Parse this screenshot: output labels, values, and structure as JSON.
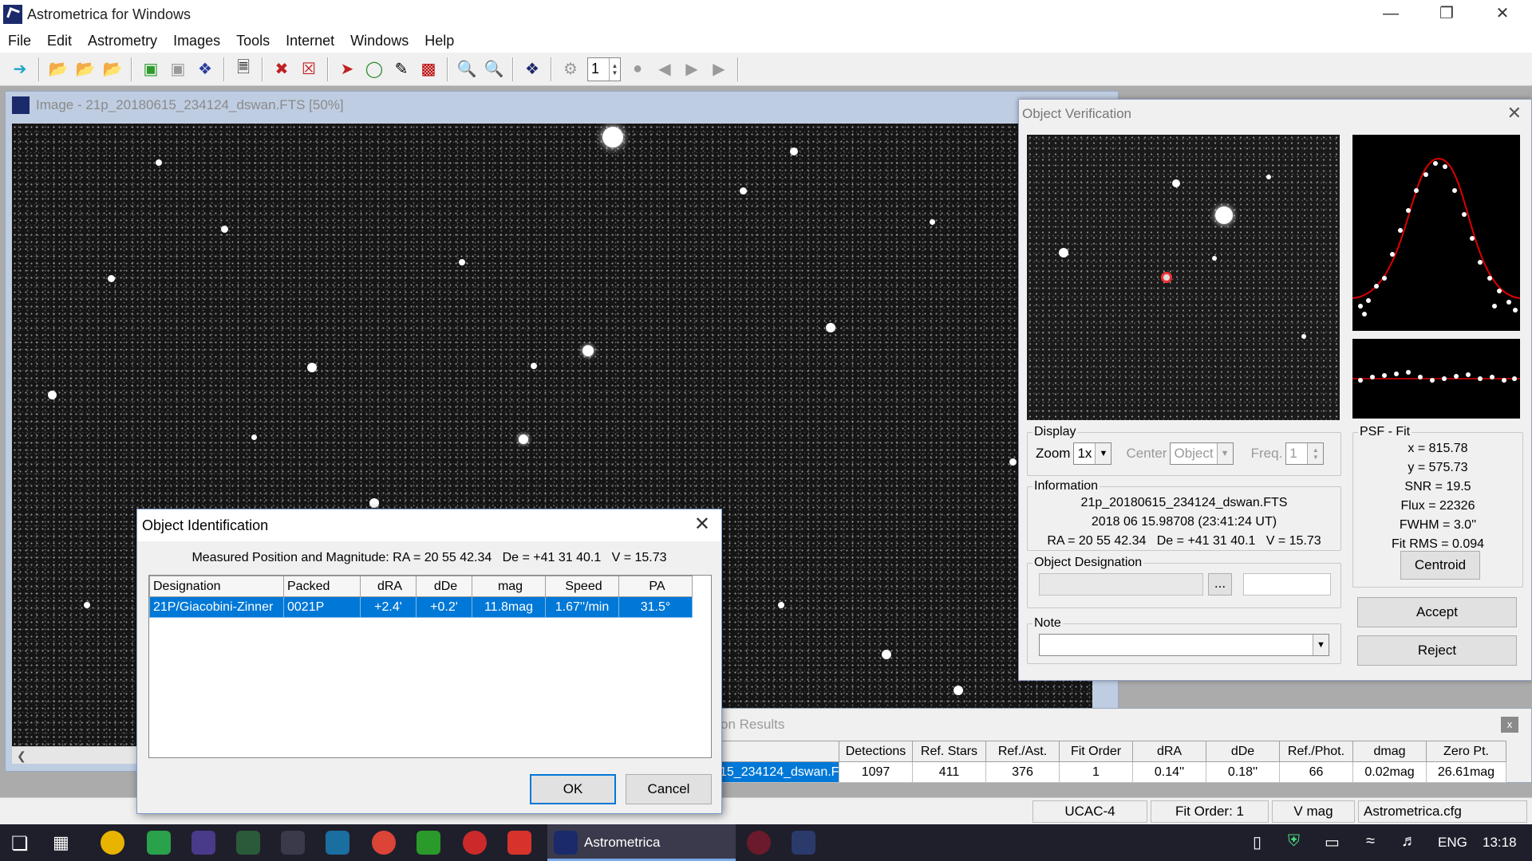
{
  "app": {
    "title": "Astrometrica for Windows"
  },
  "menu": [
    "File",
    "Edit",
    "Astrometry",
    "Images",
    "Tools",
    "Internet",
    "Windows",
    "Help"
  ],
  "toolbar": {
    "frame_value": "1"
  },
  "image_window": {
    "title": "Image - 21p_20180615_234124_dswan.FTS [50%]"
  },
  "verification": {
    "title": "Object Verification",
    "display": {
      "legend": "Display",
      "zoom_label": "Zoom",
      "zoom_value": "1x",
      "center_label": "Center",
      "center_value": "Object",
      "freq_label": "Freq.",
      "freq_value": "1"
    },
    "information": {
      "legend": "Information",
      "file": "21p_20180615_234124_dswan.FTS",
      "date": "2018 06 15.98708 (23:41:24 UT)",
      "coords": "RA = 20 55 42.34   De = +41 31 40.1   V = 15.73"
    },
    "designation": {
      "legend": "Object Designation",
      "browse_label": "..."
    },
    "note": {
      "legend": "Note"
    },
    "psf": {
      "legend": "PSF - Fit",
      "x": "x = 815.78",
      "y": "y = 575.73",
      "snr": "SNR = 19.5",
      "flux": "Flux = 22326",
      "fwhm": "FWHM = 3.0''",
      "fitrms": "Fit RMS = 0.094"
    },
    "buttons": {
      "centroid": "Centroid",
      "accept": "Accept",
      "reject": "Reject"
    }
  },
  "results": {
    "title": "on Results",
    "headers": [
      "",
      "Detections",
      "Ref. Stars",
      "Ref./Ast.",
      "Fit Order",
      "dRA",
      "dDe",
      "Ref./Phot.",
      "dmag",
      "Zero Pt."
    ],
    "row": [
      "15_234124_dswan.F",
      "1097",
      "411",
      "376",
      "1",
      "0.14''",
      "0.18''",
      "66",
      "0.02mag",
      "26.61mag"
    ],
    "close_label": "x"
  },
  "statusbar": {
    "catalog": "UCAC-4",
    "fit_order": "Fit Order: 1",
    "mag": "V mag",
    "config": "Astrometrica.cfg"
  },
  "dialog": {
    "title": "Object Identification",
    "measured": "Measured Position and Magnitude: RA = 20 55 42.34   De = +41 31 40.1   V = 15.73",
    "headers": [
      "Designation",
      "Packed",
      "dRA",
      "dDe",
      "mag",
      "Speed",
      "PA"
    ],
    "rows": [
      [
        "21P/Giacobini-Zinner",
        "0021P",
        "+2.4'",
        "+0.2'",
        "11.8mag",
        "1.67''/min",
        "31.5°"
      ]
    ],
    "ok": "OK",
    "cancel": "Cancel"
  },
  "taskbar": {
    "active_app": "Astrometrica",
    "lang": "ENG",
    "clock": "13:18"
  }
}
